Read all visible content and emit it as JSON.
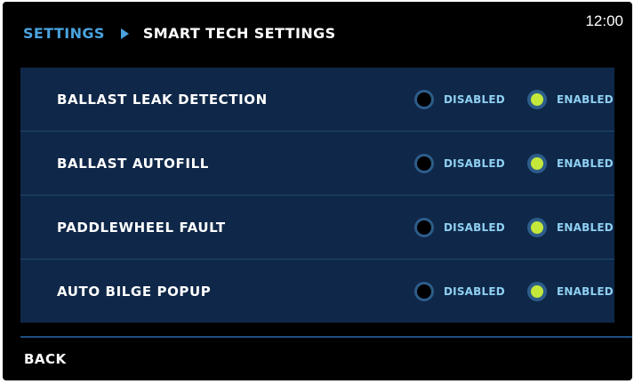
{
  "header": {
    "breadcrumb_root": "SETTINGS",
    "breadcrumb_current": "SMART TECH SETTINGS",
    "clock": "12:00"
  },
  "settings": [
    {
      "label": "BALLAST LEAK DETECTION",
      "disabled_label": "DISABLED",
      "enabled_label": "ENABLED",
      "value": "enabled"
    },
    {
      "label": "BALLAST AUTOFILL",
      "disabled_label": "DISABLED",
      "enabled_label": "ENABLED",
      "value": "enabled"
    },
    {
      "label": "PADDLEWHEEL FAULT",
      "disabled_label": "DISABLED",
      "enabled_label": "ENABLED",
      "value": "enabled"
    },
    {
      "label": "AUTO BILGE POPUP",
      "disabled_label": "DISABLED",
      "enabled_label": "ENABLED",
      "value": "enabled"
    }
  ],
  "footer": {
    "back_label": "BACK"
  },
  "colors": {
    "background": "#000000",
    "panel": "#0f2748",
    "accent_blue": "#4aa3df",
    "option_text": "#8fd0f2",
    "radio_on": "#c3e83a",
    "radio_ring": "#2d5c8a"
  },
  "icons": {
    "breadcrumb_separator": "triangle-right-icon"
  }
}
